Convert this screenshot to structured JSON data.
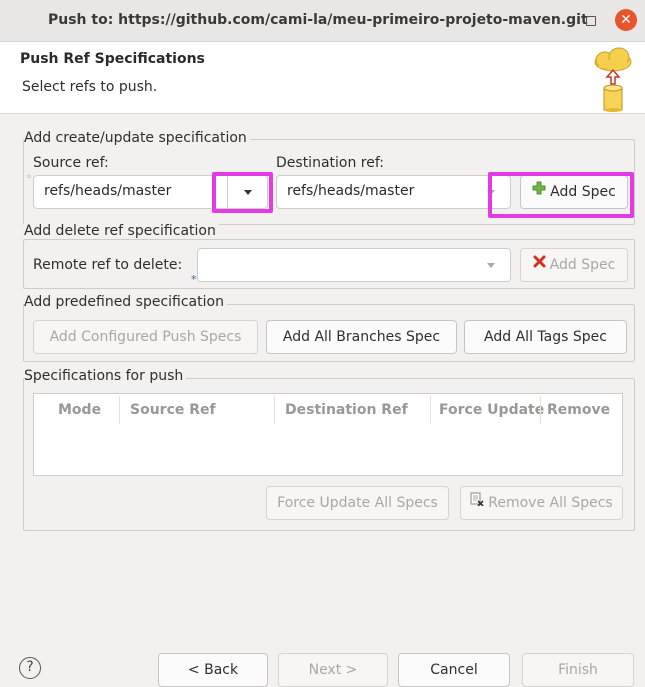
{
  "window": {
    "title": "Push to: https://github.com/cami-la/meu-primeiro-projeto-maven.git",
    "close_glyph": "✕"
  },
  "header": {
    "title": "Push Ref Specifications",
    "subtitle": "Select refs to push.",
    "icon": "cloud-push-database-icon"
  },
  "create_update": {
    "legend": "Add create/update specification",
    "source_label": "Source ref:",
    "source_value": "refs/heads/master",
    "destination_label": "Destination ref:",
    "destination_value": "refs/heads/master",
    "add_spec_label": "Add Spec"
  },
  "delete_ref": {
    "legend": "Add delete ref specification",
    "remote_label": "Remote ref to delete:",
    "remote_value": "",
    "add_spec_label": "Add Spec"
  },
  "predefined": {
    "legend": "Add predefined specification",
    "configured_label": "Add Configured Push Specs",
    "branches_label": "Add All Branches Spec",
    "tags_label": "Add All Tags Spec"
  },
  "specs": {
    "legend": "Specifications for push",
    "columns": [
      "Mode",
      "Source Ref",
      "Destination Ref",
      "Force Update",
      "Remove"
    ],
    "rows": [],
    "force_update_all_label": "Force Update All Specs",
    "remove_all_label": "Remove All Specs"
  },
  "footer": {
    "help_glyph": "?",
    "back_label": "< Back",
    "next_label": "Next >",
    "cancel_label": "Cancel",
    "finish_label": "Finish"
  },
  "colors": {
    "highlight": "#e23be6",
    "add_icon": "#4e9a06",
    "remove_icon": "#cc0000"
  }
}
